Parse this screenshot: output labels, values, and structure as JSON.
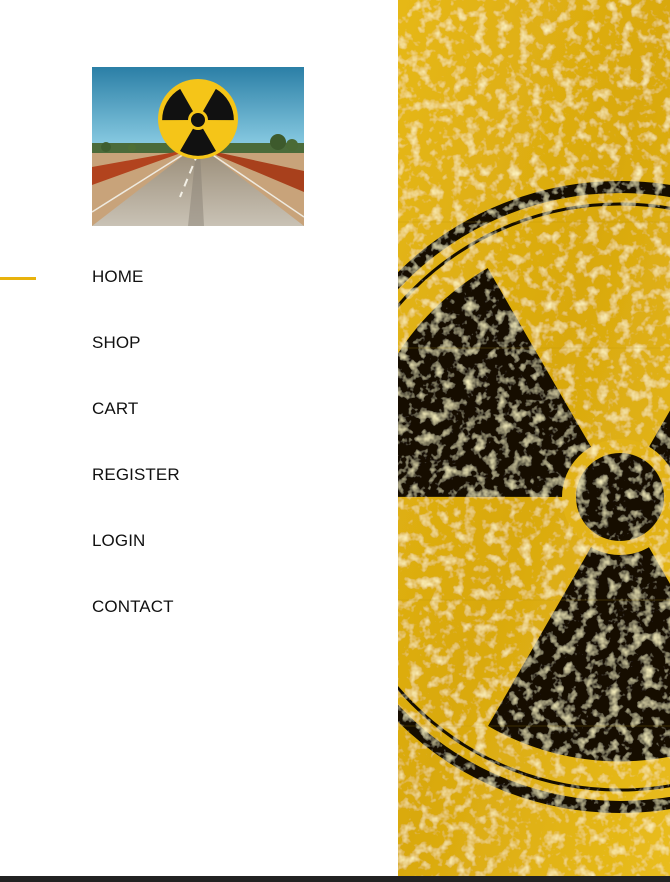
{
  "logo": {
    "icon": "radiation-trefoil-over-road",
    "sky_color": "#4aa7c9",
    "sun_color": "#f5c518"
  },
  "nav": {
    "active_index": 0,
    "accent": "#e8b20c",
    "items": [
      {
        "label": "HOME"
      },
      {
        "label": "SHOP"
      },
      {
        "label": "CART"
      },
      {
        "label": "REGISTER"
      },
      {
        "label": "LOGIN"
      },
      {
        "label": "CONTACT"
      }
    ]
  },
  "hero": {
    "icon": "radiation-hazard-symbol",
    "background_color": "#e2b313",
    "symbol_color": "#111111"
  }
}
